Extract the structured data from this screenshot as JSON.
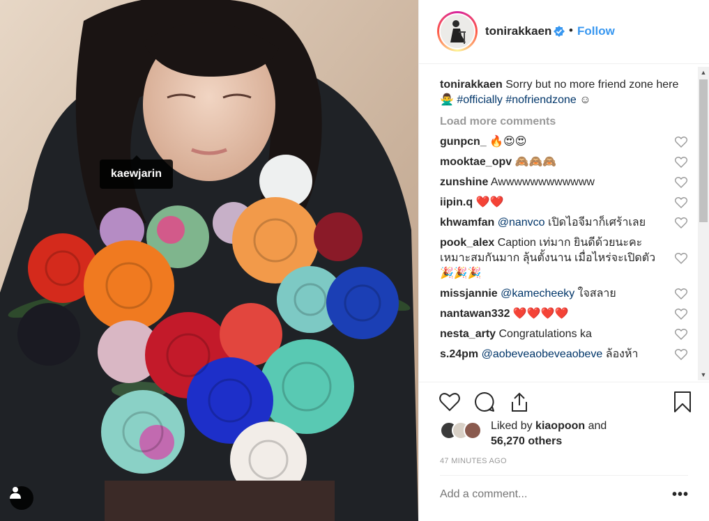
{
  "post": {
    "username": "tonirakkaen",
    "follow_label": "Follow",
    "separator": "•",
    "tagged_user": "kaewjarin",
    "caption": {
      "username": "tonirakkaen",
      "text": " Sorry but no more friend zone here🙅‍♂ ",
      "hashtag1": "#officially",
      "hashtag2": "#nofriendzone",
      "tail": " ☺"
    },
    "load_more": "Load more comments",
    "comments": [
      {
        "user": "gunpcn_",
        "text": " 🔥😍😍"
      },
      {
        "user": "mooktae_opv",
        "text": " 🙈🙈🙈"
      },
      {
        "user": "zunshine",
        "text": " Awwwwwwwwwwww"
      },
      {
        "user": "iipin.q",
        "text": " ❤️❤️"
      },
      {
        "user": "khwamfan",
        "mention": "@nanvco",
        "text": " เปิดไอจีมาก็เศร้าเลย"
      },
      {
        "user": "pook_alex",
        "text": " Caption เท่มาก ยินดีด้วยนะคะ เหมาะสมกันมาก ลุ้นตั้งนาน เมื่อไหร่จะเปิดตัว 🎉🎉🎉"
      },
      {
        "user": "missjannie",
        "mention": "@kamecheeky",
        "text": " ใจสลาย"
      },
      {
        "user": "nantawan332",
        "text": " ❤️❤️❤️❤️"
      },
      {
        "user": "nesta_arty",
        "text": " Congratulations ka"
      },
      {
        "user": "s.24pm",
        "mention": "@aobeveaobeveaobeve",
        "text": " ล้องห้า"
      }
    ],
    "liked_by_prefix": "Liked by ",
    "liked_by_user": "kiaopoon",
    "liked_by_and": " and",
    "liked_by_others": "56,270 others",
    "timestamp": "47 MINUTES AGO",
    "add_comment_placeholder": "Add a comment...",
    "more_options": "•••"
  },
  "colors": {
    "accent": "#3897f0",
    "hashtag": "#003569",
    "muted": "#999999",
    "text": "#262626"
  },
  "icons": [
    "verified-icon",
    "heart-icon",
    "comment-icon",
    "share-icon",
    "bookmark-icon",
    "user-tags-icon"
  ]
}
